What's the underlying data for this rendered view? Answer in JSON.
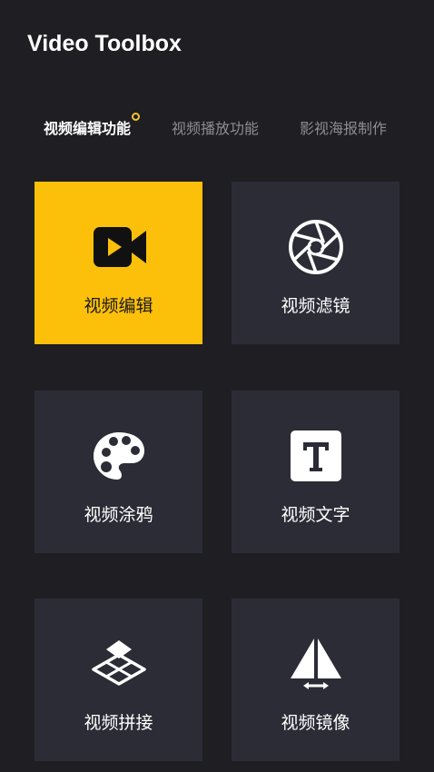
{
  "app": {
    "title": "Video Toolbox"
  },
  "tabs": [
    {
      "label": "视频编辑功能",
      "active": true
    },
    {
      "label": "视频播放功能",
      "active": false
    },
    {
      "label": "影视海报制作",
      "active": false
    }
  ],
  "tiles": [
    {
      "label": "视频编辑",
      "icon": "video-camera-icon",
      "selected": true
    },
    {
      "label": "视频滤镜",
      "icon": "aperture-icon",
      "selected": false
    },
    {
      "label": "视频涂鸦",
      "icon": "palette-icon",
      "selected": false
    },
    {
      "label": "视频文字",
      "icon": "text-t-icon",
      "selected": false
    },
    {
      "label": "视频拼接",
      "icon": "layers-icon",
      "selected": false
    },
    {
      "label": "视频镜像",
      "icon": "mirror-icon",
      "selected": false
    }
  ],
  "colors": {
    "background": "#1f1e22",
    "tile": "#2c2c36",
    "accent": "#fcc00a",
    "text": "#ffffff",
    "tab_inactive": "#8e8d92"
  }
}
